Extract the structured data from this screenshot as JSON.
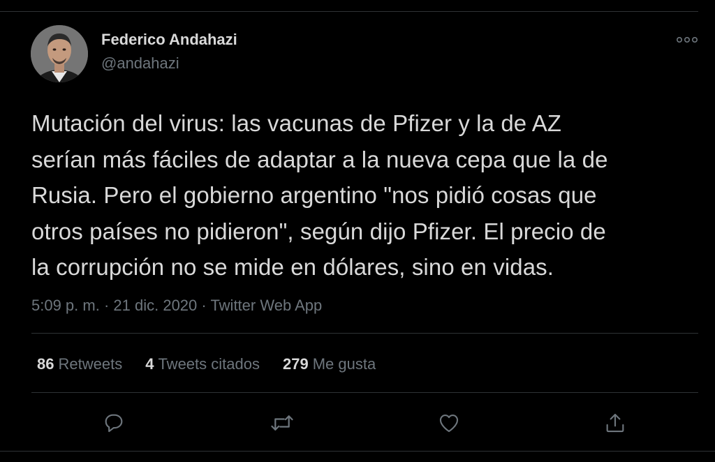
{
  "author": {
    "name": "Federico Andahazi",
    "handle": "@andahazi"
  },
  "tweet": {
    "text_lines": [
      "Mutación del virus: las vacunas de Pfizer y la de AZ",
      "serían más fáciles de adaptar a la nueva cepa que la de",
      "Rusia. Pero el gobierno argentino \"nos pidió cosas que",
      "otros países no pidieron\", según dijo Pfizer. El precio de",
      "la corrupción no se mide en dólares, sino en vidas."
    ]
  },
  "meta": {
    "time": "5:09 p. m.",
    "separator": " · ",
    "date": "21 dic. 2020",
    "source": "Twitter Web App"
  },
  "stats": {
    "retweets": {
      "count": "86",
      "label": "Retweets"
    },
    "quotes": {
      "count": "4",
      "label": "Tweets citados"
    },
    "likes": {
      "count": "279",
      "label": "Me gusta"
    }
  },
  "icons": {
    "more": "more-options-icon",
    "reply": "reply-icon",
    "retweet": "retweet-icon",
    "like": "heart-icon",
    "share": "share-icon"
  },
  "colors": {
    "background": "#000000",
    "text": "#d9d9d9",
    "secondary": "#6e767d",
    "border": "#2f3336"
  }
}
